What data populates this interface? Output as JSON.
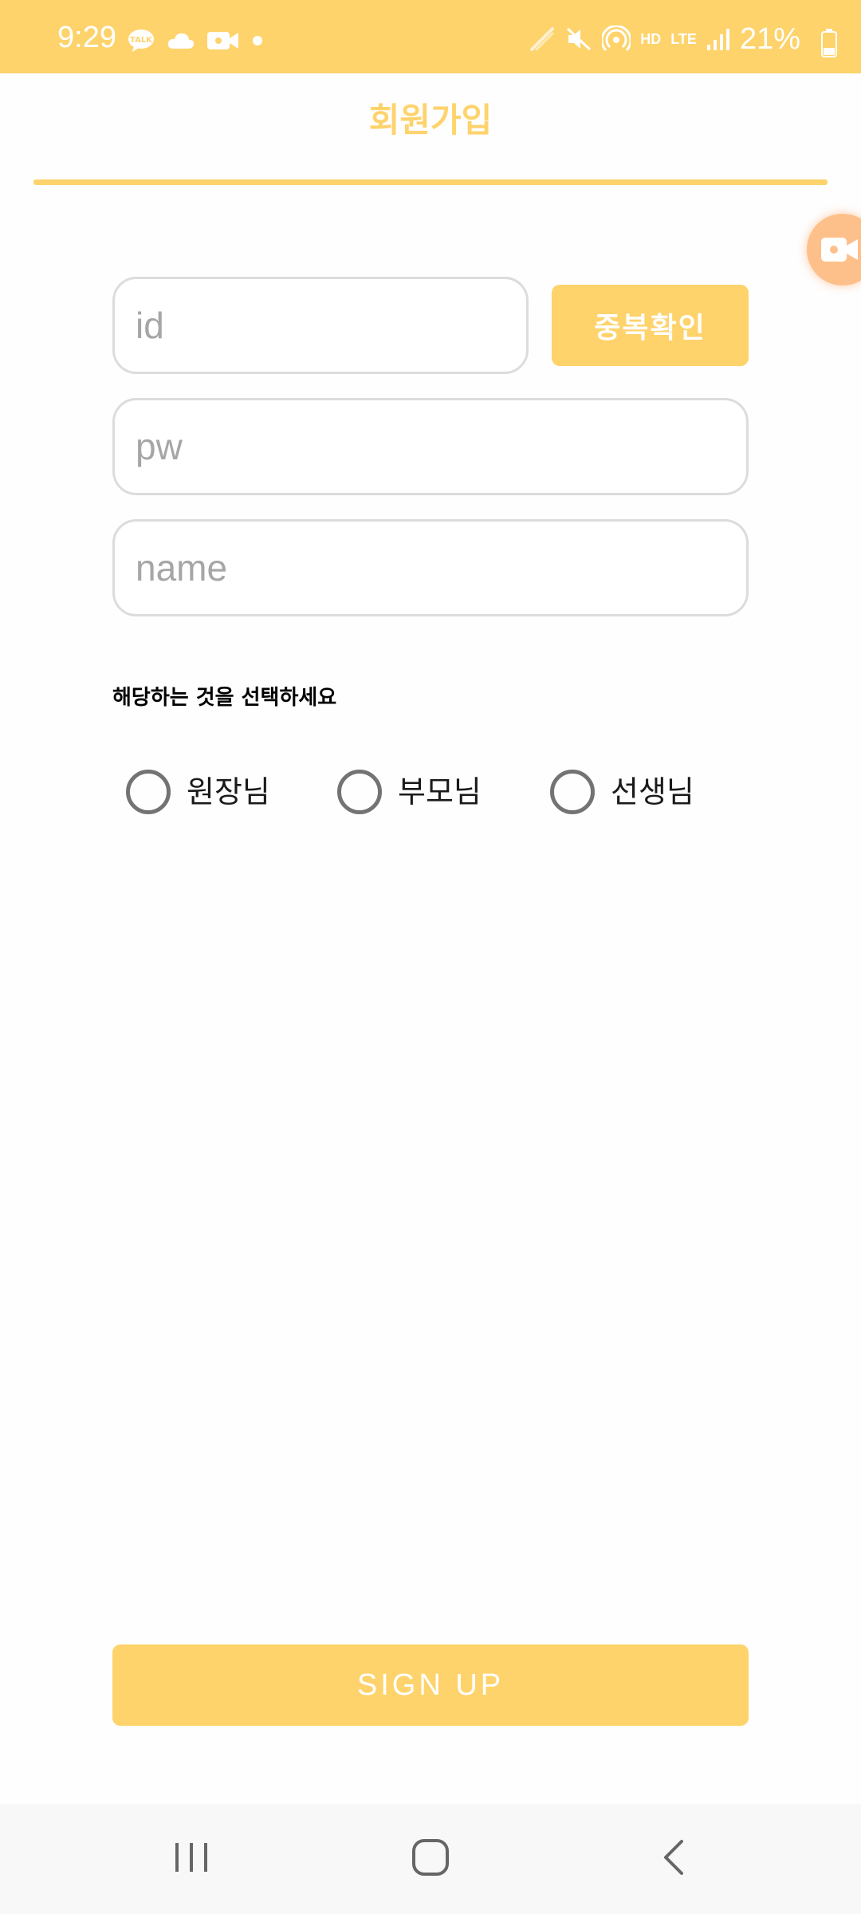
{
  "status_bar": {
    "time": "9:29",
    "battery_percent": "21%",
    "hd_label": "HD",
    "network_label": "LTE",
    "left_icons": [
      "talk-icon",
      "cloud-icon",
      "video-camera-icon",
      "dot-icon"
    ],
    "right_icons": [
      "nfc-icon",
      "mute-icon",
      "hotspot-icon",
      "hd-voice-icon",
      "lte-icon",
      "signal-icon",
      "battery-icon"
    ]
  },
  "header": {
    "title": "회원가입"
  },
  "form": {
    "id_placeholder": "id",
    "pw_placeholder": "pw",
    "name_placeholder": "name",
    "check_duplicate_label": "중복확인",
    "role_prompt": "해당하는 것을 선택하세요",
    "roles": [
      {
        "label": "원장님",
        "selected": false
      },
      {
        "label": "부모님",
        "selected": false
      },
      {
        "label": "선생님",
        "selected": false
      }
    ],
    "sign_up_label": "SIGN UP"
  },
  "colors": {
    "accent": "#fed36c",
    "input_border": "#dcdcdc",
    "radio_border": "#737373",
    "placeholder": "#a6a6a6",
    "nav_background": "#f8f8f8"
  },
  "nav_bar": {
    "buttons": [
      "recents-icon",
      "home-icon",
      "back-icon"
    ]
  }
}
